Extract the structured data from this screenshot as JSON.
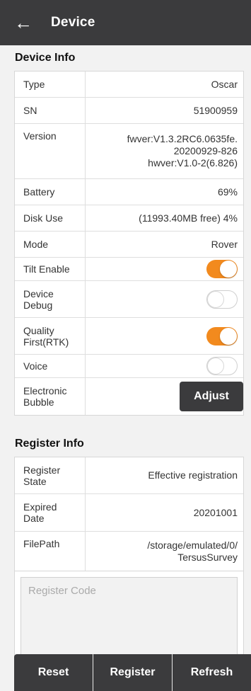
{
  "header": {
    "title": "Device"
  },
  "device_info": {
    "title": "Device Info",
    "type": {
      "label": "Type",
      "value": "Oscar"
    },
    "sn": {
      "label": "SN",
      "value": "51900959"
    },
    "version": {
      "label": "Version",
      "line1": "fwver:V1.3.2RC6.0635fe.",
      "line2": "20200929-826",
      "line3": "hwver:V1.0-2(6.826)"
    },
    "battery": {
      "label": "Battery",
      "value": "69%"
    },
    "disk_use": {
      "label": "Disk Use",
      "value": "(11993.40MB free) 4%"
    },
    "mode": {
      "label": "Mode",
      "value": "Rover"
    },
    "tilt_enable": {
      "label": "Tilt Enable",
      "on": true
    },
    "device_debug": {
      "label": "Device Debug",
      "on": false
    },
    "quality_first": {
      "label": "Quality First(RTK)",
      "on": true
    },
    "voice": {
      "label": "Voice",
      "on": false
    },
    "electronic_bubble": {
      "label": "Electronic Bubble",
      "button": "Adjust"
    }
  },
  "register_info": {
    "title": "Register Info",
    "state": {
      "label": "Register State",
      "value": "Effective registration"
    },
    "expired": {
      "label": "Expired Date",
      "value": "20201001"
    },
    "filepath": {
      "label": "FilePath",
      "line1": "/storage/emulated/0/",
      "line2": "TersusSurvey"
    },
    "code_placeholder": "Register Code"
  },
  "bottom_bar": {
    "reset": "Reset",
    "register": "Register",
    "refresh": "Refresh"
  },
  "colors": {
    "header_bg": "#3b3b3d",
    "toggle_on": "#f28a1e",
    "page_bg": "#f2f2f2"
  }
}
